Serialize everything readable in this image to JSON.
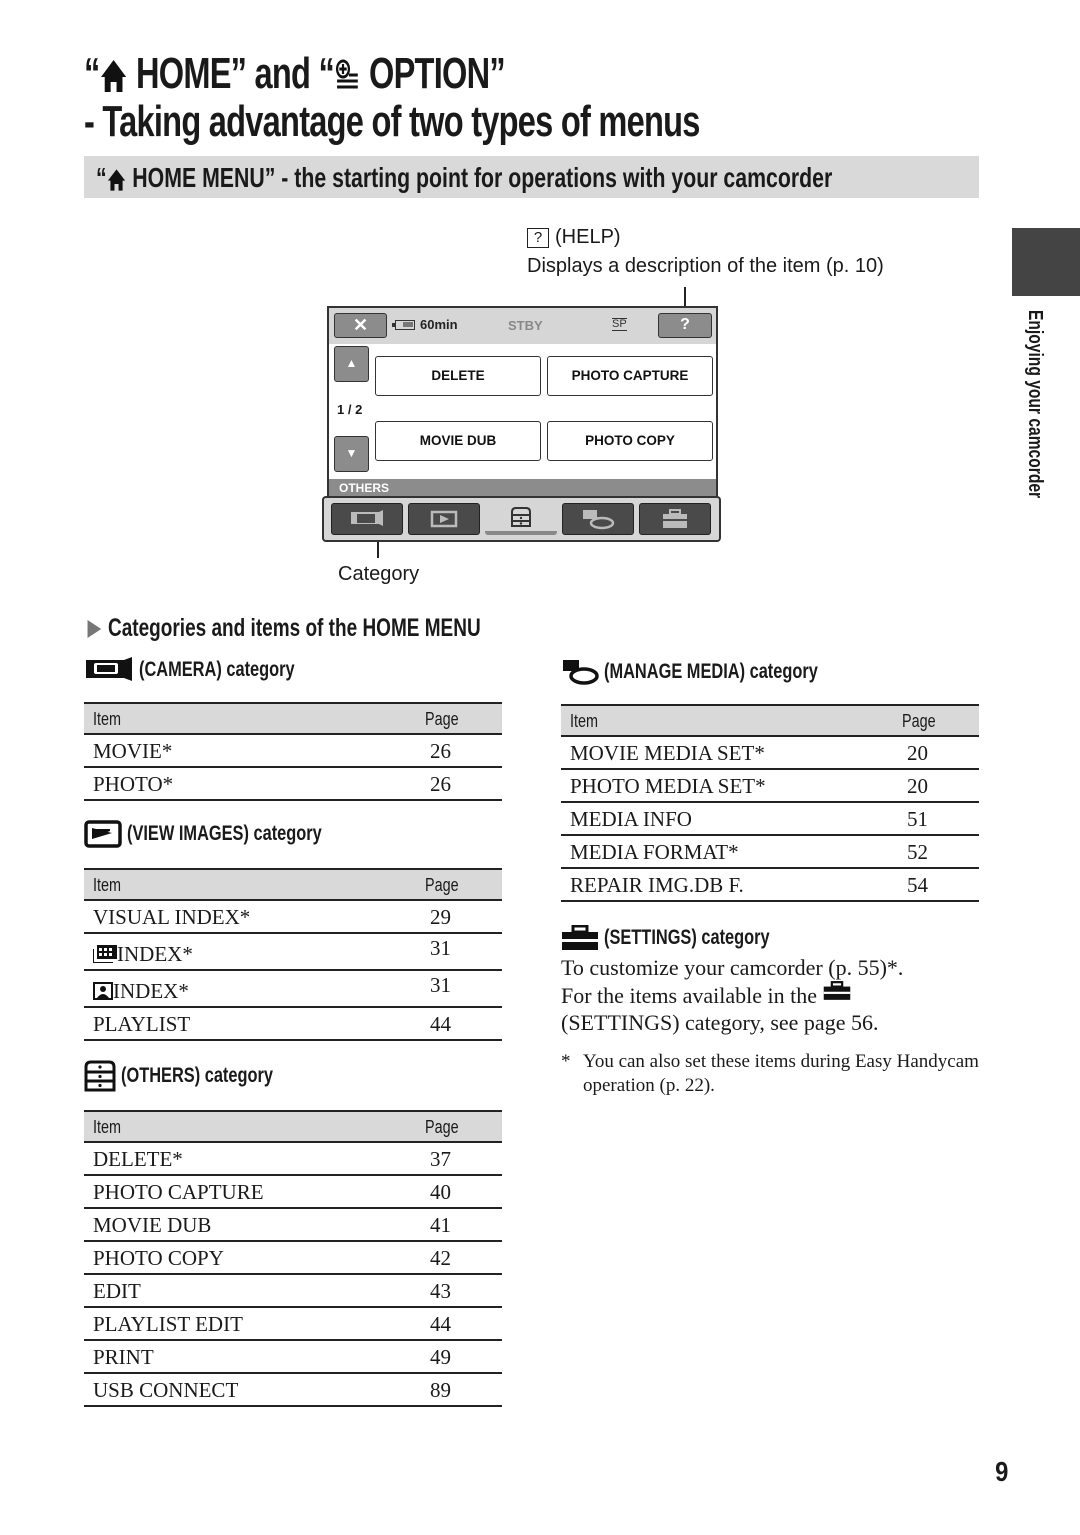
{
  "title": {
    "line1_part1": "“",
    "line1_home": " HOME” and “",
    "line1_option": " OPTION”",
    "line2": "- Taking advantage of two types of menus"
  },
  "section_band": {
    "prefix": "“",
    "text": " HOME MENU” - the starting point for operations with your camcorder"
  },
  "help_callout": {
    "icon_text": "?",
    "label": "(HELP)",
    "description": "Displays a description of the item (p. 10)"
  },
  "lcd": {
    "close_icon": "✕",
    "battery_time": "60min",
    "status": "STBY",
    "quality": "SP",
    "help_button": "?",
    "up_arrow": "▲",
    "down_arrow": "▼",
    "page_indicator": "1 / 2",
    "items": [
      "DELETE",
      "PHOTO CAPTURE",
      "MOVIE DUB",
      "PHOTO COPY"
    ],
    "category_bar": "OTHERS",
    "tabs": [
      "camera",
      "view-images",
      "others",
      "manage-media",
      "settings"
    ],
    "active_tab": "others"
  },
  "category_callout": "Category",
  "side_tab": "Enjoying your camcorder",
  "categories_heading": "Categories and items of the HOME MENU",
  "camera": {
    "heading": "(CAMERA) category",
    "col_item": "Item",
    "col_page": "Page",
    "rows": [
      {
        "item": "MOVIE*",
        "page": "26"
      },
      {
        "item": "PHOTO*",
        "page": "26"
      }
    ]
  },
  "view_images": {
    "heading": "(VIEW IMAGES) category",
    "col_item": "Item",
    "col_page": "Page",
    "rows": [
      {
        "item": "VISUAL INDEX*",
        "page": "29"
      },
      {
        "item": "INDEX*",
        "page": "31",
        "icon": "film-index-icon"
      },
      {
        "item": "INDEX*",
        "page": "31",
        "icon": "face-index-icon"
      },
      {
        "item": "PLAYLIST",
        "page": "44"
      }
    ]
  },
  "others": {
    "heading": "(OTHERS) category",
    "col_item": "Item",
    "col_page": "Page",
    "rows": [
      {
        "item": "DELETE*",
        "page": "37"
      },
      {
        "item": "PHOTO CAPTURE",
        "page": "40"
      },
      {
        "item": "MOVIE DUB",
        "page": "41"
      },
      {
        "item": "PHOTO COPY",
        "page": "42"
      },
      {
        "item": "EDIT",
        "page": "43"
      },
      {
        "item": "PLAYLIST EDIT",
        "page": "44"
      },
      {
        "item": "PRINT",
        "page": "49"
      },
      {
        "item": "USB CONNECT",
        "page": "89"
      }
    ]
  },
  "manage_media": {
    "heading": "(MANAGE MEDIA) category",
    "col_item": "Item",
    "col_page": "Page",
    "rows": [
      {
        "item": "MOVIE MEDIA SET*",
        "page": "20"
      },
      {
        "item": "PHOTO MEDIA SET*",
        "page": "20"
      },
      {
        "item": "MEDIA INFO",
        "page": "51"
      },
      {
        "item": "MEDIA FORMAT*",
        "page": "52"
      },
      {
        "item": "REPAIR IMG.DB F.",
        "page": "54"
      }
    ]
  },
  "settings": {
    "heading": "(SETTINGS) category",
    "line1": "To customize your camcorder (p. 55)*.",
    "line2_pre": "For the items available in the ",
    "line3": "(SETTINGS) category, see page 56."
  },
  "footnote": {
    "marker": "*",
    "text": "You can also set these items during Easy Handycam operation (p. 22)."
  },
  "page_number": "9"
}
